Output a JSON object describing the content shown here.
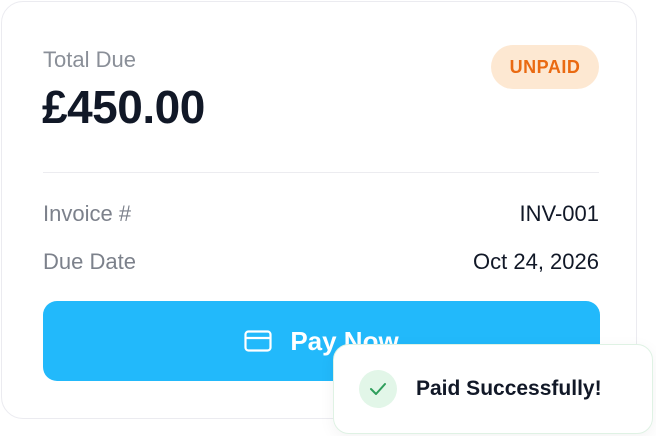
{
  "invoice": {
    "total_label": "Total Due",
    "amount": "£450.00",
    "status_badge": "UNPAID",
    "fields": [
      {
        "label": "Invoice #",
        "value": "INV-001"
      },
      {
        "label": "Due Date",
        "value": "Oct 24, 2026"
      }
    ],
    "pay_button": {
      "label": "Pay Now",
      "icon": "credit-card-icon"
    }
  },
  "toast": {
    "message": "Paid Successfully!",
    "icon": "check-icon"
  },
  "colors": {
    "accent": "#22b9fb",
    "badge_bg": "#fde8d2",
    "badge_text": "#ea6a12",
    "success": "#2e9e5b"
  }
}
